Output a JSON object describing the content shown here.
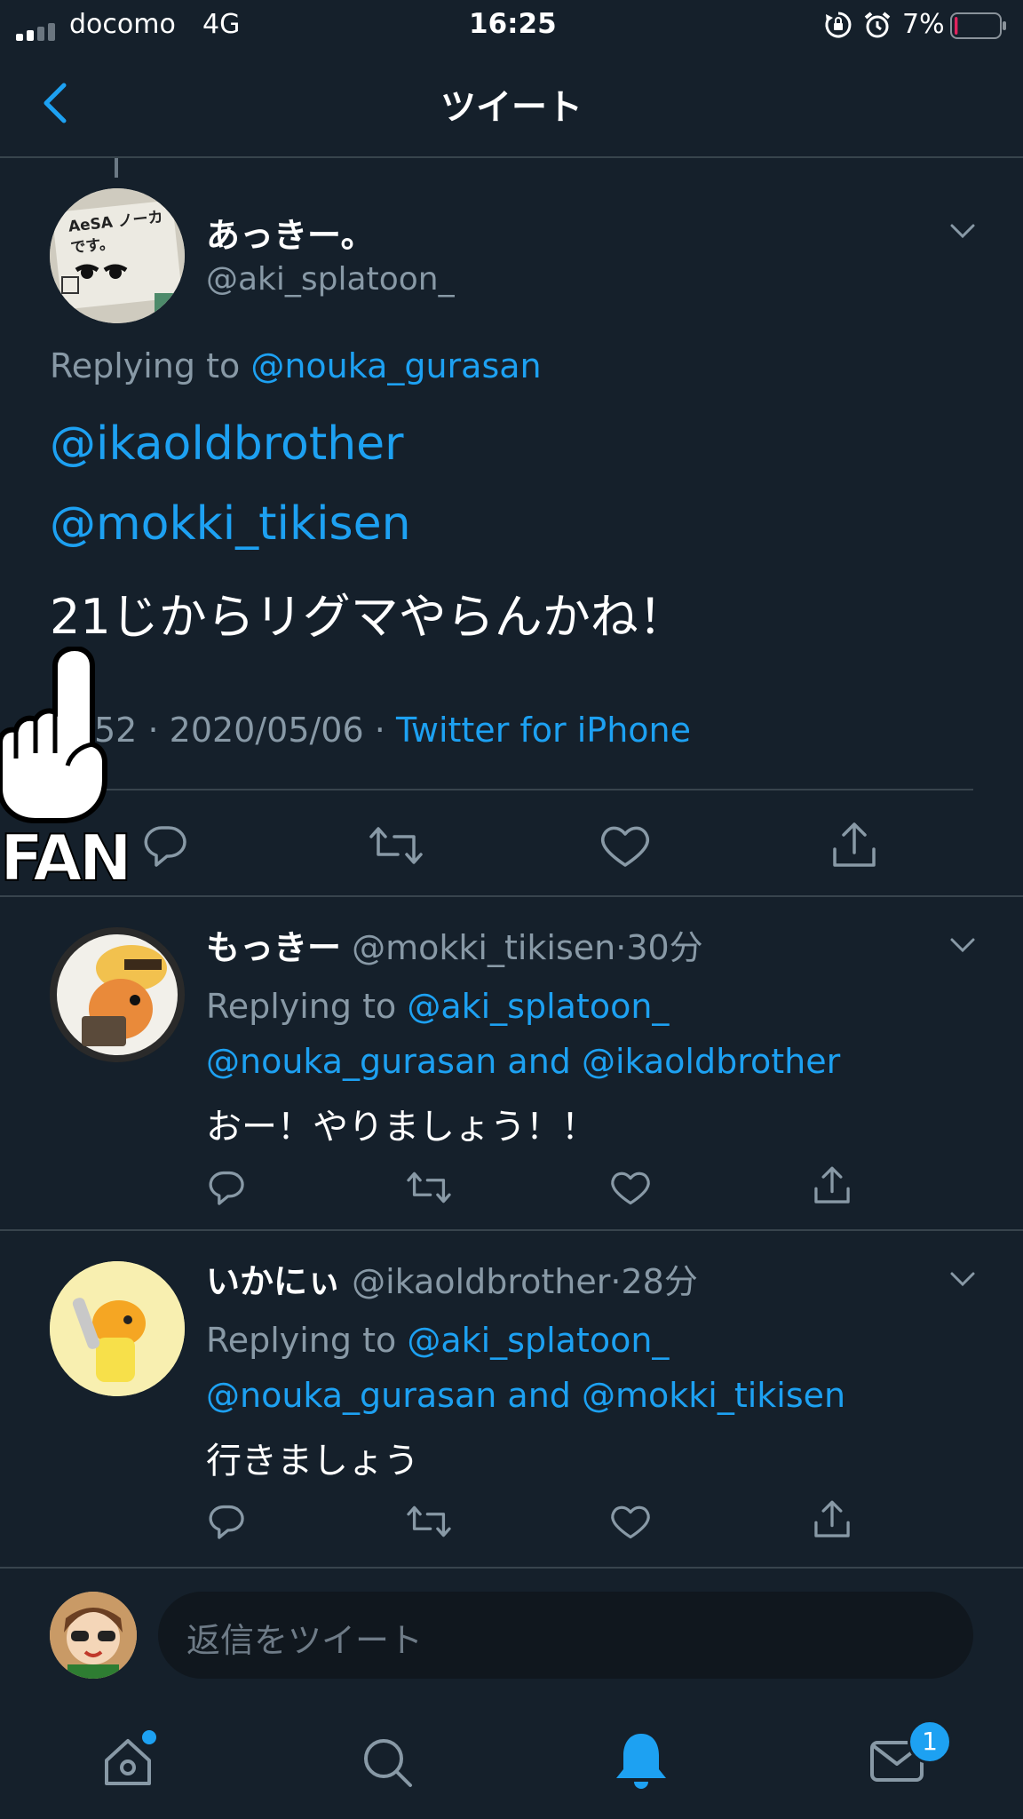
{
  "status_bar": {
    "carrier": "docomo",
    "network": "4G",
    "time": "16:25",
    "battery": "7%",
    "battery_level": 0.07
  },
  "header": {
    "title": "ツイート"
  },
  "main_tweet": {
    "display_name": "あっきー。",
    "handle": "@aki_splatoon_",
    "avatar_text": "AeSA ノーカです。",
    "replying_prefix": "Replying to ",
    "replying_handle": "@nouka_gurasan",
    "mention_1": "@ikaoldbrother",
    "mention_2": "@mokki_tikisen",
    "body": "21じからリグマやらんかね！",
    "time_partial": "52",
    "dot": "·",
    "date": "2020/05/06",
    "source": "Twitter for iPhone"
  },
  "overlay": {
    "text": "FAN"
  },
  "replies": [
    {
      "display_name": "もっきー",
      "handle": "@mokki_tikisen",
      "age": "30分",
      "replying_prefix": "Replying to ",
      "replying_line1": "@aki_splatoon_",
      "replying_line2_a": "@nouka_gurasan",
      "replying_and": " and ",
      "replying_line2_b": "@ikaoldbrother",
      "body": "おー！やりましょう！！"
    },
    {
      "display_name": "いかにぃ",
      "handle": "@ikaoldbrother",
      "age": "28分",
      "replying_prefix": "Replying to ",
      "replying_line1": "@aki_splatoon_",
      "replying_line2_a": "@nouka_gurasan",
      "replying_and": " and ",
      "replying_line2_b": "@mokki_tikisen",
      "body": "行きましょう"
    }
  ],
  "composer": {
    "placeholder": "返信をツイート"
  },
  "tab_bar": {
    "messages_badge": "1",
    "icons": [
      "home-icon",
      "search-icon",
      "notifications-icon",
      "messages-icon"
    ]
  },
  "colors": {
    "background": "#15202b",
    "accent": "#1da1f2",
    "secondary_text": "#8899a6",
    "divider": "#38444d",
    "battery_low": "#e0245e"
  }
}
